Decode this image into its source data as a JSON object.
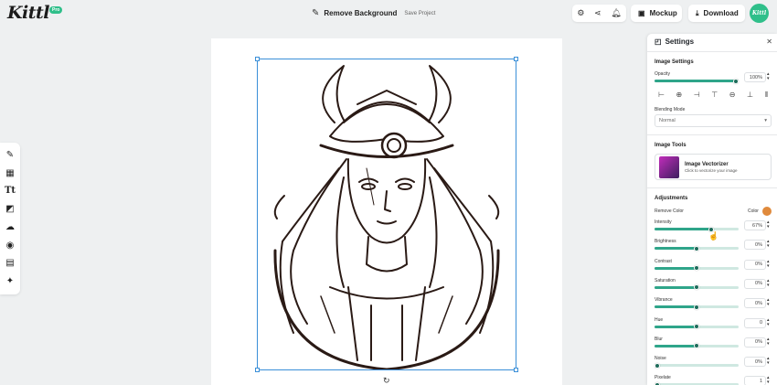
{
  "app": {
    "logo": "Kittl",
    "badge": "Pro"
  },
  "project": {
    "name": "Remove Background",
    "save": "Save Project"
  },
  "toolbar": {
    "mockup": "Mockup",
    "download": "Download",
    "avatar": "Kittl"
  },
  "settings": {
    "title": "Settings",
    "image_settings": "Image Settings",
    "opacity": {
      "label": "Opacity",
      "value": "100%",
      "level": 1.0
    },
    "blending": {
      "label": "Blending Mode",
      "value": "Normal"
    },
    "image_tools": "Image Tools",
    "vectorizer": {
      "title": "Image Vectorizer",
      "subtitle": "Click to vectorize your image"
    },
    "adjustments": "Adjustments",
    "remove_color": {
      "label": "Remove Color",
      "color_label": "Color",
      "color": "#e08a3c"
    },
    "sliders": [
      {
        "label": "Intensity",
        "value": "67%",
        "level": 0.67
      },
      {
        "label": "Brightness",
        "value": "0%",
        "level": 0.5
      },
      {
        "label": "Contrast",
        "value": "0%",
        "level": 0.5
      },
      {
        "label": "Saturation",
        "value": "0%",
        "level": 0.5
      },
      {
        "label": "Vibrance",
        "value": "0%",
        "level": 0.5
      },
      {
        "label": "Hue",
        "value": "0",
        "level": 0.5
      },
      {
        "label": "Blur",
        "value": "0%",
        "level": 0.5
      },
      {
        "label": "Noise",
        "value": "0%",
        "level": 0.0
      },
      {
        "label": "Pixelate",
        "value": "1",
        "level": 0.0
      }
    ]
  },
  "colors": {
    "accent": "#2fa58a",
    "brand": "#2fbf8a",
    "selection": "#3a8fd8"
  }
}
